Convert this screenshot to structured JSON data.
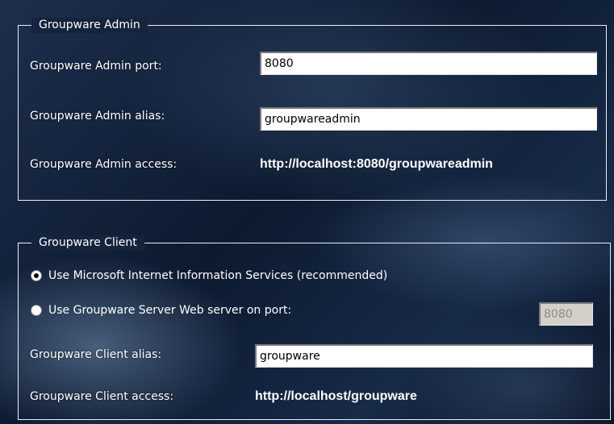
{
  "admin": {
    "legend": "Groupware Admin",
    "port_label": "Groupware Admin port:",
    "port_value": "8080",
    "alias_label": "Groupware Admin alias:",
    "alias_value": "groupwareadmin",
    "access_label": "Groupware Admin access:",
    "access_url": "http://localhost:8080/groupwareadmin"
  },
  "client": {
    "legend": "Groupware Client",
    "option_iis": {
      "label": "Use Microsoft Internet Information Services (recommended)",
      "selected": true
    },
    "option_builtin": {
      "label": "Use Groupware Server Web server on port:",
      "selected": false
    },
    "port_value": "8080",
    "alias_label": "Groupware Client alias:",
    "alias_value": "groupware",
    "access_label": "Groupware Client access:",
    "access_url": "http://localhost/groupware"
  }
}
